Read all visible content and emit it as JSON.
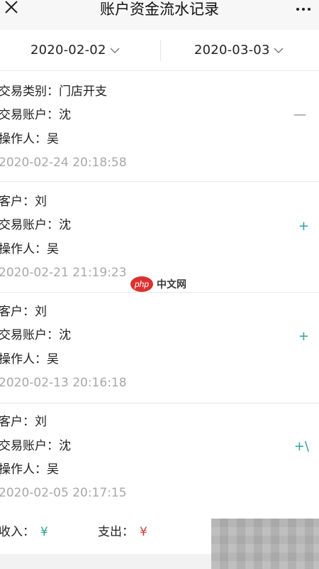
{
  "header": {
    "title": "账户资金流水记录",
    "close_icon": "close-icon",
    "more_icon": "more-dots-icon"
  },
  "filters": {
    "start_date": "2020-02-02",
    "end_date": "2020-03-03",
    "dropdown_icon": "chevron-down-icon"
  },
  "records": [
    {
      "line1": "交易类别：门店开支",
      "line2": "交易账户：沈",
      "line3": "操作人：吴",
      "time": "2020-02-24 20:18:58",
      "sign": "—"
    },
    {
      "line1": "客户：刘",
      "line2": "交易账户：沈",
      "line3": "操作人：吴",
      "time": "2020-02-21 21:19:23",
      "sign": "+"
    },
    {
      "line1": "客户：刘",
      "line2": "交易账户：沈",
      "line3": "操作人：吴",
      "time": "2020-02-13 20:16:18",
      "sign": "+"
    },
    {
      "line1": "客户：刘",
      "line2": "交易账户：沈",
      "line3": "操作人：吴",
      "time": "2020-02-05 20:17:15",
      "sign": "+\\"
    }
  ],
  "summary": {
    "income_label": "收入：",
    "income_currency": "¥",
    "expense_label": "支出：",
    "expense_currency": "¥"
  },
  "watermark": {
    "logo": "php",
    "site": "中文网"
  },
  "colors": {
    "income": "#2f9f8a",
    "expense": "#d23b3b",
    "plus_sign": "#2f9fa0",
    "watermark_red": "#d9312f"
  }
}
